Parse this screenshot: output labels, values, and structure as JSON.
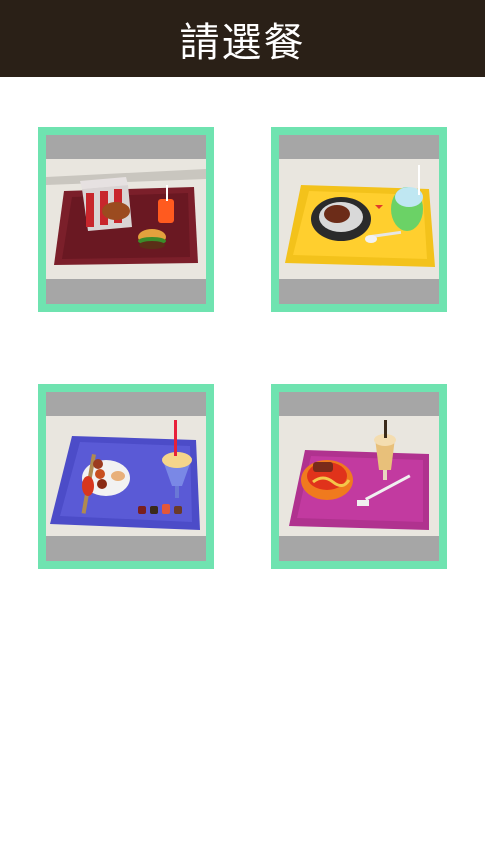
{
  "header": {
    "title": "請選餐"
  },
  "colors": {
    "header_bg": "#2a2017",
    "card_border": "#6fe3b0",
    "card_letterbox": "#a6a6a6"
  },
  "meals": [
    {
      "tray_color": "#7b1f2a",
      "icon": "fried-chicken-burger-tray-image"
    },
    {
      "tray_color": "#ffc62a",
      "icon": "curry-rice-drink-tray-image"
    },
    {
      "tray_color": "#5a5ad6",
      "icon": "skewers-sushi-parfait-tray-image"
    },
    {
      "tray_color": "#c23aa0",
      "icon": "noodle-bowl-milkshake-tray-image"
    }
  ]
}
